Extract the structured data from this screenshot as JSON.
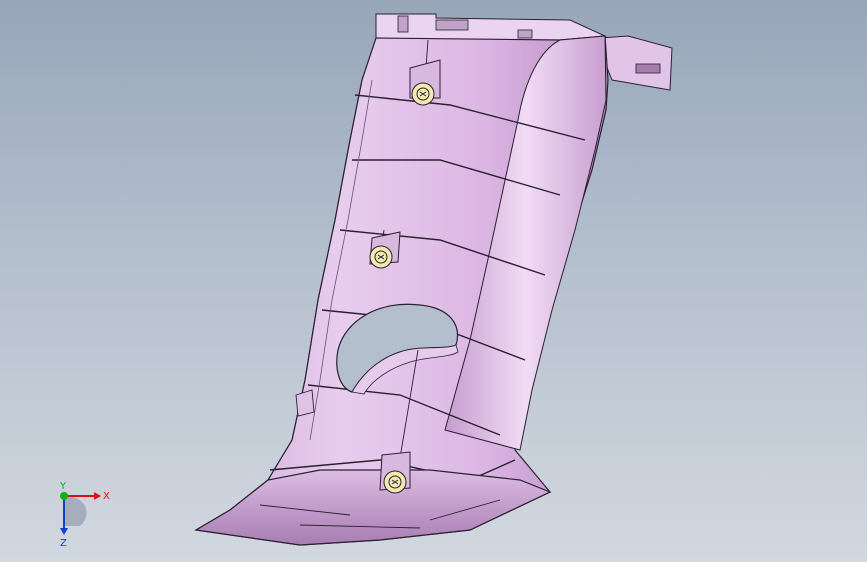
{
  "viewport": {
    "background_top": "#98a6ba",
    "background_bottom": "#d2d8e0"
  },
  "part": {
    "color": "#e4c8ea",
    "shade_color": "#c8a0d0",
    "edge_color": "#2a2030",
    "fastener_count": 3,
    "fastener_icon": "clip-fastener-icon"
  },
  "triad": {
    "x_label": "X",
    "y_label": "Y",
    "z_label": "Z",
    "x_color": "#e01010",
    "y_color": "#10b010",
    "z_color": "#1040d0"
  }
}
